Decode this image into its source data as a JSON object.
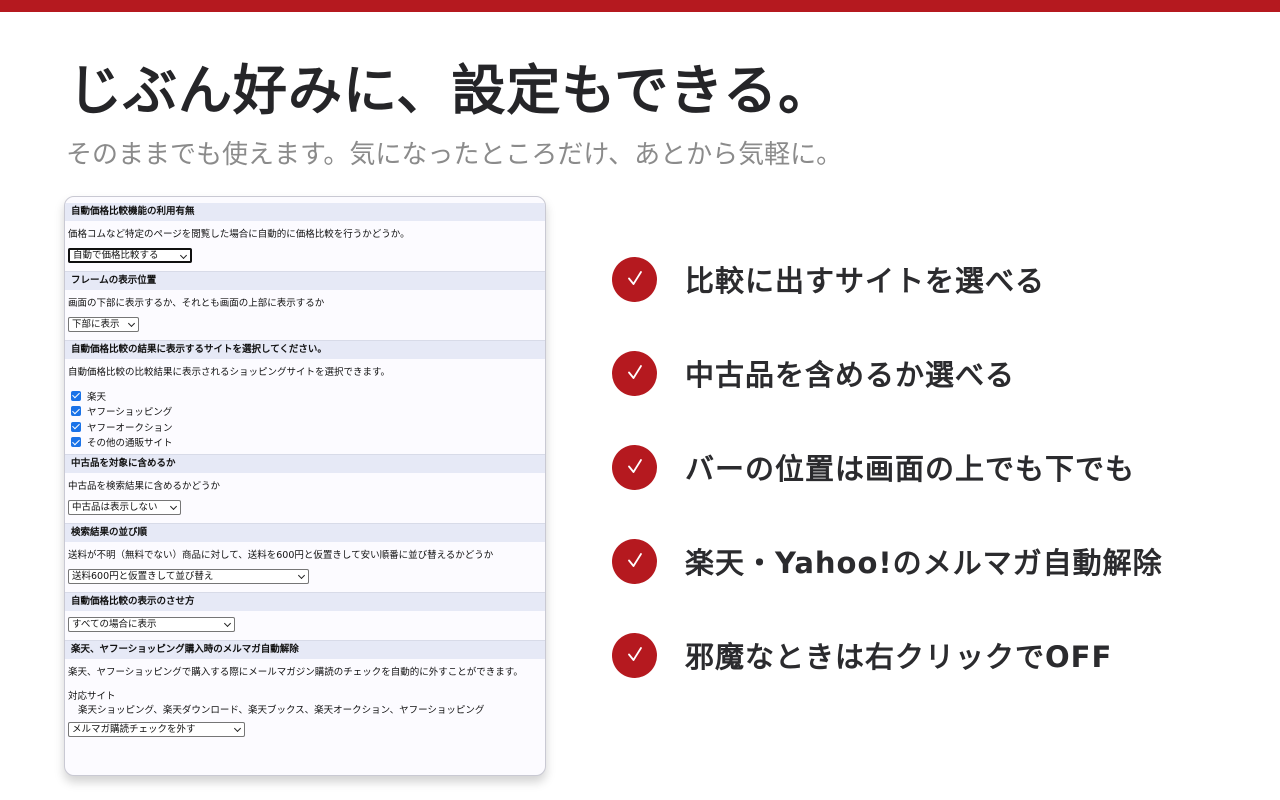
{
  "colors": {
    "accent": "#b5191f",
    "checkbox": "#1a73e8"
  },
  "headline": "じぶん好みに、設定もできる。",
  "subhead": "そのままでも使えます。気になったところだけ、あとから気軽に。",
  "settings": {
    "s1": {
      "title": "自動価格比較機能の利用有無",
      "desc": "価格コムなど特定のページを閲覧した場合に自動的に価格比較を行うかどうか。",
      "select": "自動で価格比較する"
    },
    "s2": {
      "title": "フレームの表示位置",
      "desc": "画面の下部に表示するか、それとも画面の上部に表示するか",
      "select": "下部に表示"
    },
    "s3": {
      "title": "自動価格比較の結果に表示するサイトを選択してください。",
      "desc": "自動価格比較の比較結果に表示されるショッピングサイトを選択できます。",
      "checkboxes": [
        "楽天",
        "ヤフーショッピング",
        "ヤフーオークション",
        "その他の通販サイト"
      ]
    },
    "s4": {
      "title": "中古品を対象に含めるか",
      "desc": "中古品を検索結果に含めるかどうか",
      "select": "中古品は表示しない"
    },
    "s5": {
      "title": "検索結果の並び順",
      "desc": "送料が不明（無料でない）商品に対して、送料を600円と仮置きして安い順番に並び替えるかどうか",
      "select": "送料600円と仮置きして並び替え"
    },
    "s6": {
      "title": "自動価格比較の表示のさせ方",
      "select": "すべての場合に表示"
    },
    "s7": {
      "title": "楽天、ヤフーショッピング購入時のメルマガ自動解除",
      "desc": "楽天、ヤフーショッピングで購入する際にメールマガジン購読のチェックを自動的に外すことができます。",
      "sites_label": "対応サイト",
      "sites": "楽天ショッピング、楽天ダウンロード、楽天ブックス、楽天オークション、ヤフーショッピング",
      "select": "メルマガ購読チェックを外す"
    }
  },
  "features": [
    "比較に出すサイトを選べる",
    "中古品を含めるか選べる",
    "バーの位置は画面の上でも下でも",
    "楽天・Yahoo!のメルマガ自動解除",
    "邪魔なときは右クリックでOFF"
  ]
}
